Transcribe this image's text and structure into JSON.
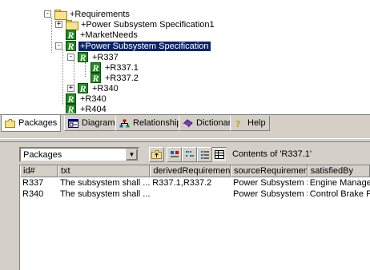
{
  "tree": {
    "nodes": [
      {
        "label": "+Requirements",
        "toggle": "-",
        "icon": "folder",
        "selected": false
      },
      {
        "label": "+Power Subsystem Specification1",
        "toggle": "+",
        "icon": "folder",
        "selected": false
      },
      {
        "label": "+MarketNeeds",
        "toggle": "",
        "icon": "requirement",
        "selected": false
      },
      {
        "label": "+Power Subsystem Specification",
        "toggle": "-",
        "icon": "requirement",
        "selected": true
      },
      {
        "label": "+R337",
        "toggle": "-",
        "icon": "requirement",
        "selected": false
      },
      {
        "label": "+R337.1",
        "toggle": "",
        "icon": "requirement",
        "selected": false
      },
      {
        "label": "+R337.2",
        "toggle": "",
        "icon": "requirement",
        "selected": false
      },
      {
        "label": "+R340",
        "toggle": "+",
        "icon": "requirement",
        "selected": false
      },
      {
        "label": "+R340",
        "toggle": "",
        "icon": "requirement",
        "selected": false
      },
      {
        "label": "+R404",
        "toggle": "",
        "icon": "requirement",
        "selected": false
      }
    ],
    "icon_letter": "R"
  },
  "tabs": [
    {
      "label": "Packages",
      "icon": "folder-icon",
      "active": true
    },
    {
      "label": "Diagrams",
      "icon": "diagram-icon",
      "active": false
    },
    {
      "label": "Relationships",
      "icon": "relationships-icon",
      "active": false
    },
    {
      "label": "Dictionary",
      "icon": "dictionary-icon",
      "active": false
    },
    {
      "label": "Help",
      "icon": "help-icon",
      "active": false
    }
  ],
  "toolbar": {
    "package_select_value": "Packages",
    "contents_label": "Contents of 'R337.1'"
  },
  "grid": {
    "columns": [
      "id#",
      "txt",
      "derivedRequirements",
      "sourceRequirement",
      "satisfiedBy"
    ],
    "rows": [
      [
        "R337",
        "The subsystem shall ...",
        "R337.1,R337.2",
        "Power Subsystem Spec",
        "Engine Managen"
      ],
      [
        "R340",
        "The subsystem shall ...",
        "",
        "Power Subsystem Spec",
        "Control Brake Fo"
      ]
    ]
  },
  "colors": {
    "selection": "#0a246a",
    "requirement_icon": "#1f8a1f",
    "panel": "#d4d0c8"
  }
}
